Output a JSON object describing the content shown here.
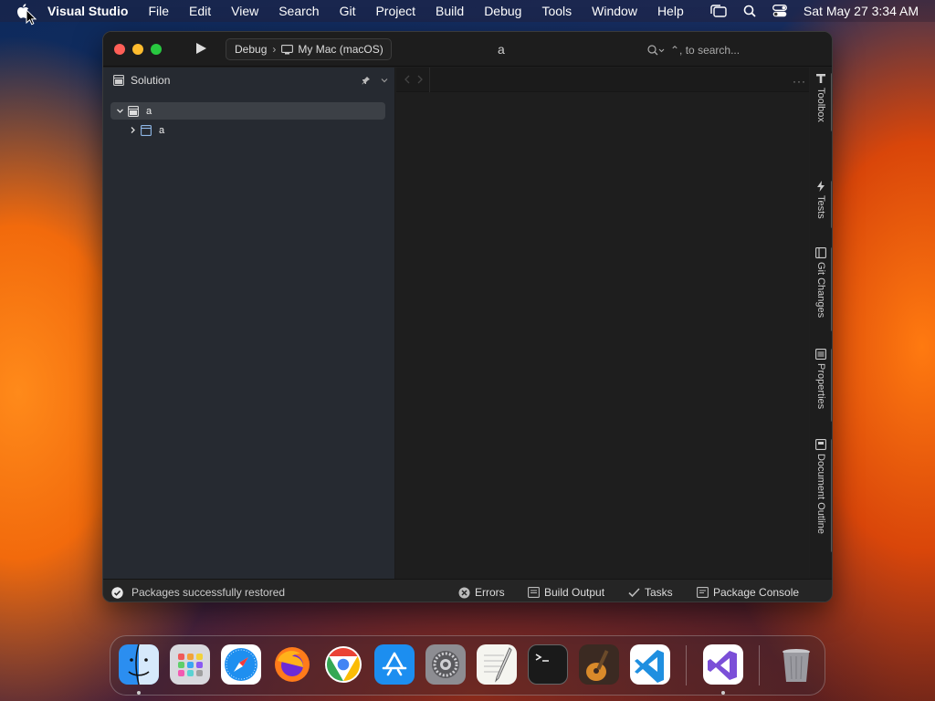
{
  "menubar": {
    "app_name": "Visual Studio",
    "items": [
      "File",
      "Edit",
      "View",
      "Search",
      "Git",
      "Project",
      "Build",
      "Debug",
      "Tools",
      "Window",
      "Help"
    ],
    "clock": "Sat May 27  3:34 AM"
  },
  "window": {
    "title": "a",
    "configuration": "Debug",
    "target": "My Mac (macOS)",
    "search_placeholder": "⌃, to search..."
  },
  "solution": {
    "header": "Solution",
    "items": [
      {
        "label": "a",
        "expanded": true
      },
      {
        "label": "a",
        "expanded": false
      }
    ]
  },
  "right_tools": [
    "Toolbox",
    "Tests",
    "Git Changes",
    "Properties",
    "Document Outline"
  ],
  "status": {
    "message": "Packages successfully restored",
    "pads": [
      "Errors",
      "Build Output",
      "Tasks",
      "Package Console"
    ]
  },
  "dock": {
    "apps": [
      "Finder",
      "Launchpad",
      "Safari",
      "Firefox",
      "Chrome",
      "App Store",
      "System Settings",
      "TextEdit",
      "Terminal",
      "GarageBand",
      "Visual Studio Code",
      "Visual Studio",
      "Trash"
    ]
  },
  "colors": {
    "accent": "#ffffff",
    "close": "#ff5f57",
    "minimize": "#febc2e",
    "zoom": "#28c840"
  }
}
